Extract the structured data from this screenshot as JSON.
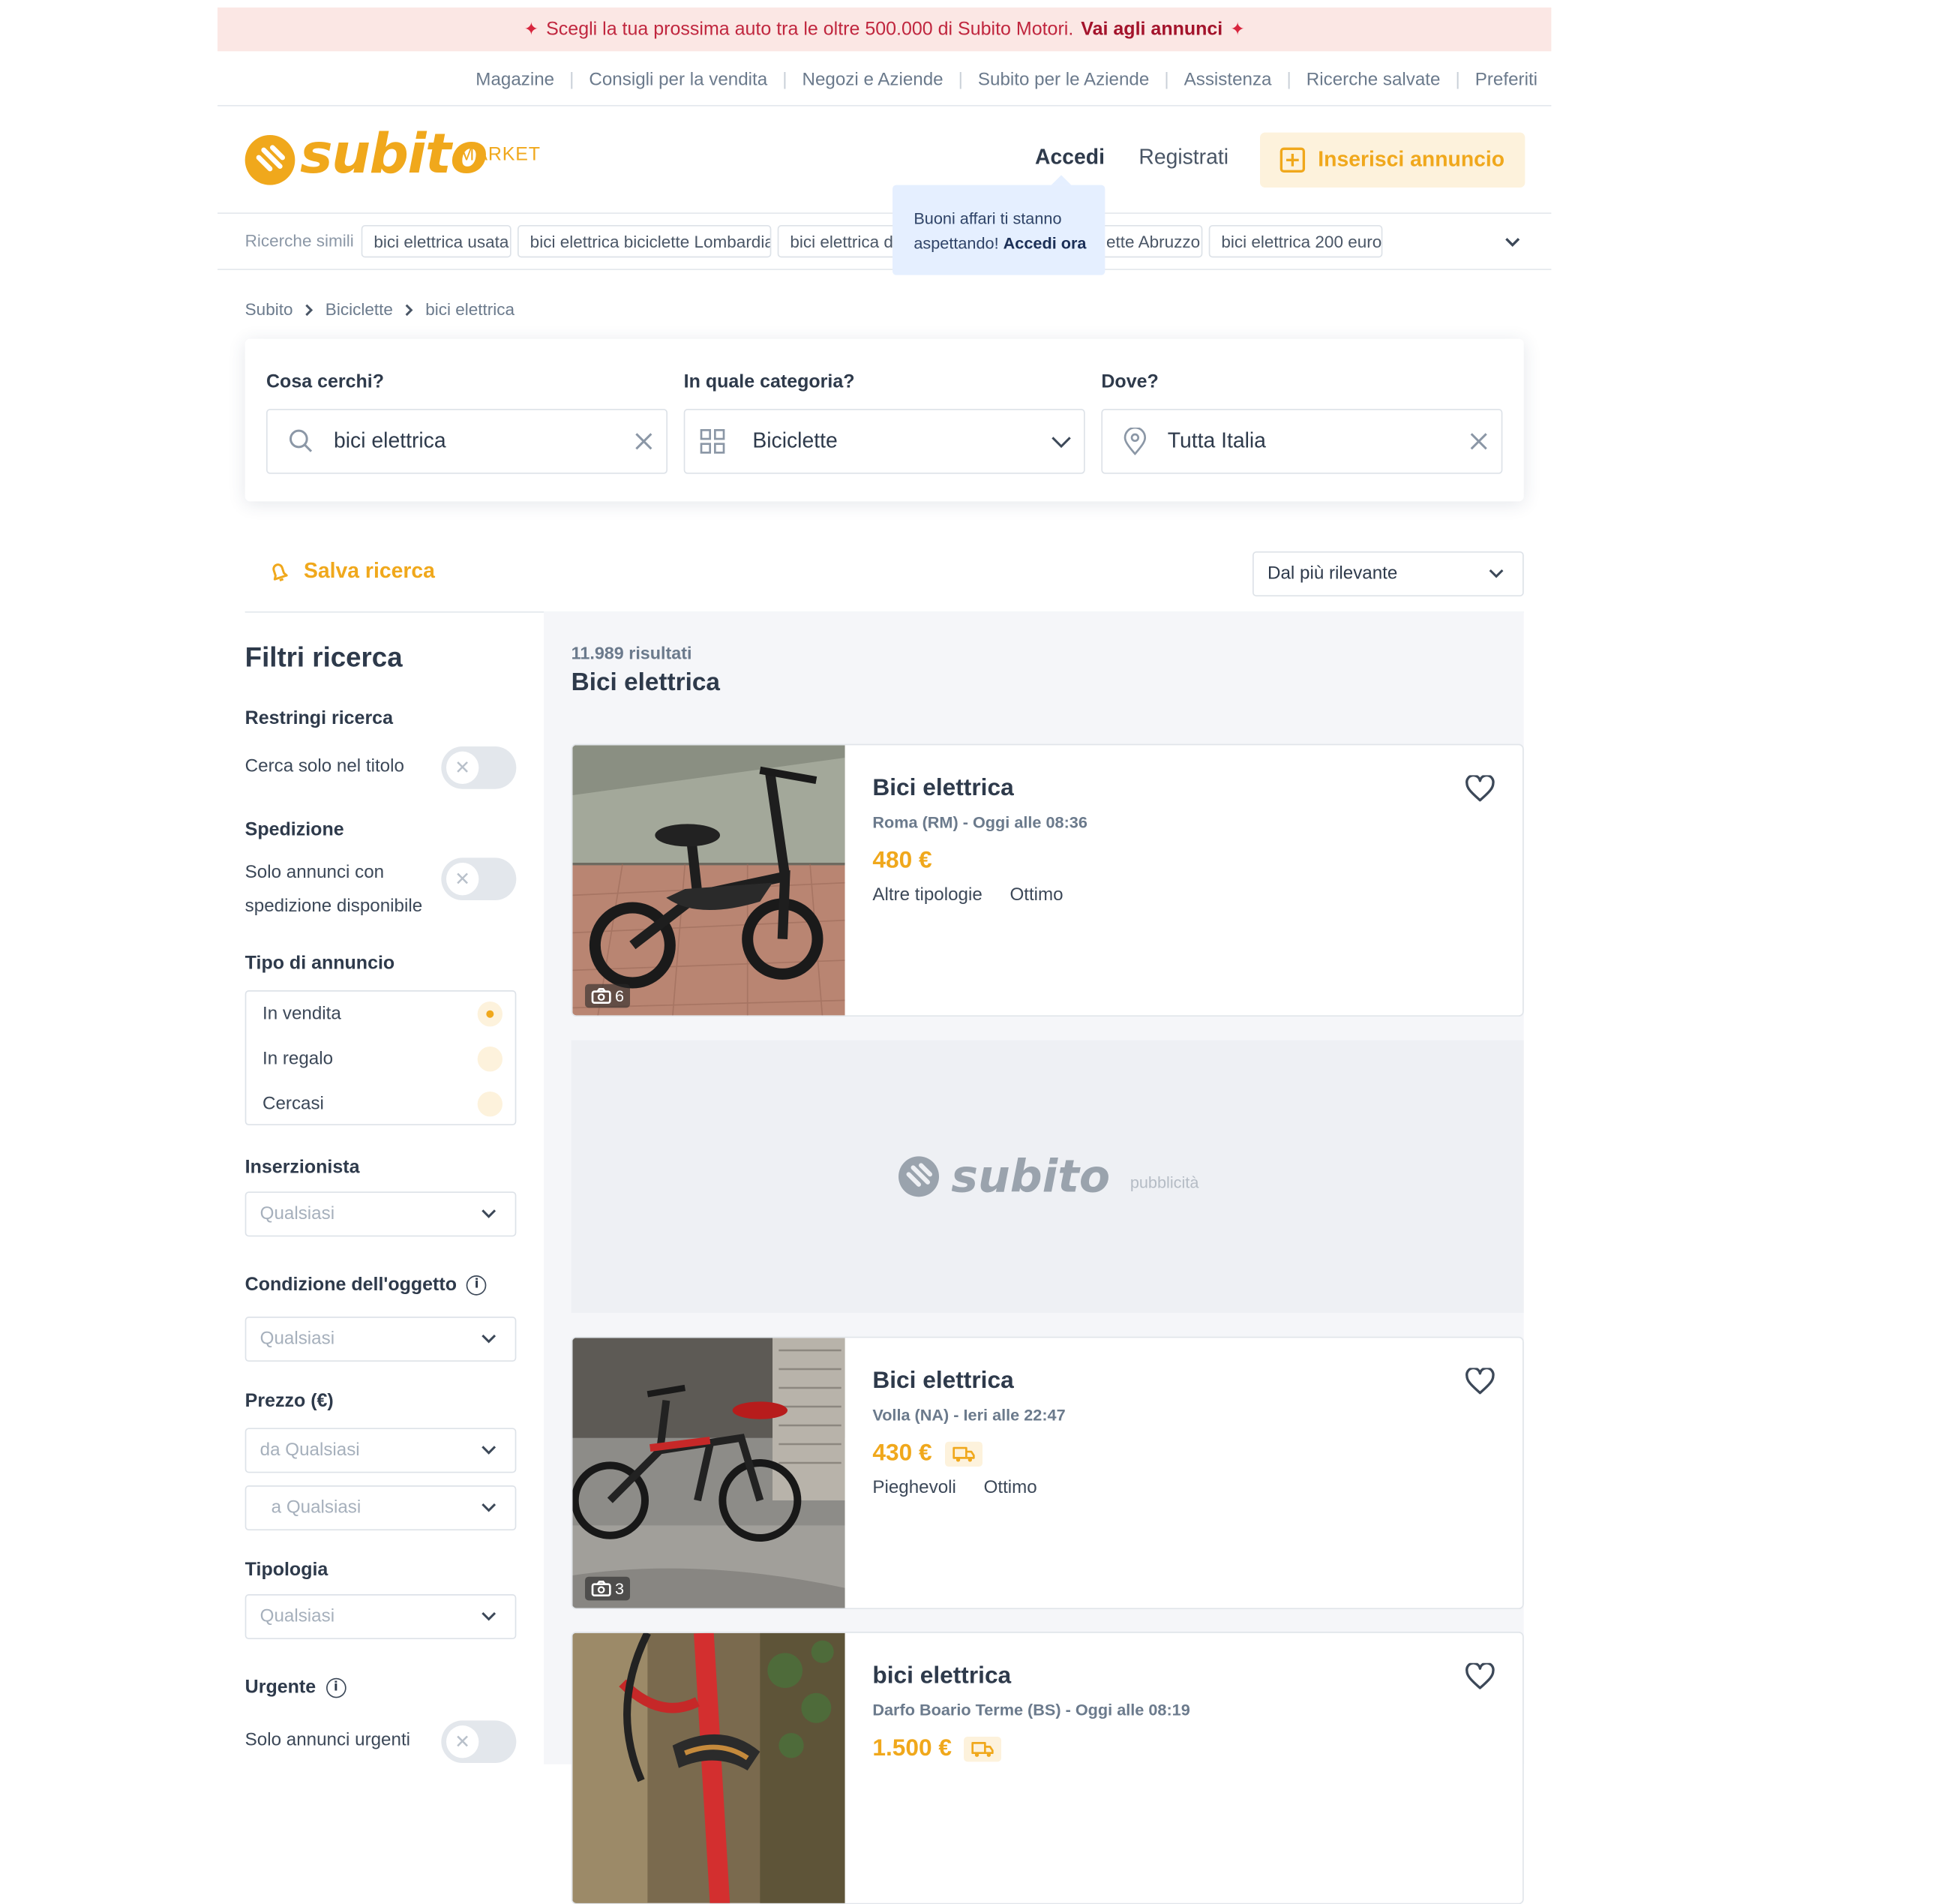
{
  "banner": {
    "text": "Scegli la tua prossima auto tra le oltre 500.000 di Subito Motori.",
    "link": "Vai agli annunci"
  },
  "top_nav": [
    "Magazine",
    "Consigli per la vendita",
    "Negozi e Aziende",
    "Subito per le Aziende",
    "Assistenza",
    "Ricerche salvate",
    "Preferiti"
  ],
  "header": {
    "logo": "subito",
    "logo_sub": "MARKET",
    "login": "Accedi",
    "register": "Registrati",
    "post_ad": "Inserisci annuncio"
  },
  "tooltip": {
    "text": "Buoni affari ti stanno aspettando!",
    "link": "Accedi ora"
  },
  "similar": {
    "label": "Ricerche simili",
    "chips": [
      "bici elettrica usata",
      "bici elettrica biciclette Lombardia",
      "bici elettrica de",
      "ette Abruzzo",
      "bici elettrica 200 euro"
    ]
  },
  "breadcrumb": [
    "Subito",
    "Biciclette",
    "bici elettrica"
  ],
  "search": {
    "what_label": "Cosa cerchi?",
    "what_value": "bici elettrica",
    "category_label": "In quale categoria?",
    "category_value": "Biciclette",
    "where_label": "Dove?",
    "where_value": "Tutta Italia"
  },
  "save_search": "Salva ricerca",
  "sort": "Dal più rilevante",
  "filters": {
    "title": "Filtri ricerca",
    "restrict_head": "Restringi ricerca",
    "title_only": "Cerca solo nel titolo",
    "shipping_head": "Spedizione",
    "shipping_line1": "Solo annunci con",
    "shipping_line2": "spedizione disponibile",
    "ad_type_head": "Tipo di annuncio",
    "ad_types": [
      "In vendita",
      "In regalo",
      "Cercasi"
    ],
    "selected_ad_type": "In vendita",
    "advertiser_head": "Inserzionista",
    "advertiser_value": "Qualsiasi",
    "condition_head": "Condizione dell'oggetto",
    "condition_value": "Qualsiasi",
    "price_head": "Prezzo (€)",
    "price_from": "da Qualsiasi",
    "price_to": "a Qualsiasi",
    "type_head": "Tipologia",
    "type_value": "Qualsiasi",
    "urgent_head": "Urgente",
    "urgent_text": "Solo annunci urgenti"
  },
  "results": {
    "count": "11.989 risultati",
    "query_title": "Bici elettrica"
  },
  "listings": [
    {
      "title": "Bici elettrica",
      "location": "Roma (RM) - Oggi alle 08:36",
      "price": "480 €",
      "shipping": false,
      "tags": [
        "Altre tipologie",
        "Ottimo"
      ],
      "photos": "6"
    },
    {
      "title": "Bici elettrica",
      "location": "Volla (NA) - Ieri alle 22:47",
      "price": "430 €",
      "shipping": true,
      "tags": [
        "Pieghevoli",
        "Ottimo"
      ],
      "photos": "3"
    },
    {
      "title": "bici elettrica",
      "location": "Darfo Boario Terme (BS) - Oggi alle 08:19",
      "price": "1.500 €",
      "shipping": true,
      "tags": [],
      "photos": ""
    }
  ],
  "ad": {
    "logo": "subito",
    "label": "pubblicità"
  },
  "colors": {
    "brand": "#f0a81c",
    "banner_bg": "#fbe7e4",
    "tooltip_bg": "#e5efff"
  }
}
